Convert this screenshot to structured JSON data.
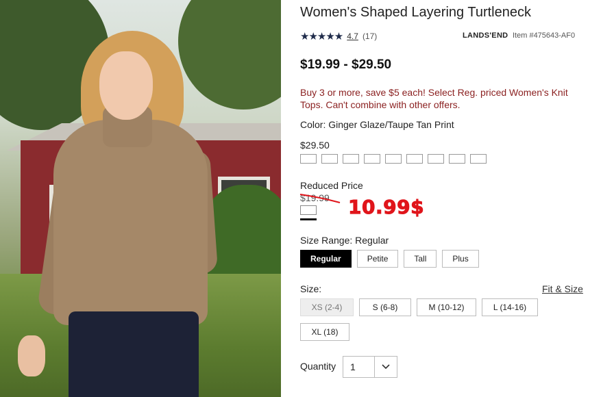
{
  "product": {
    "title": "Women's Shaped Layering Turtleneck",
    "rating_stars": "★★★★★",
    "rating_value": "4.7",
    "rating_count": "(17)",
    "brand": "LANDS'END",
    "item_number": "Item #475643-AF0",
    "price_range": "$19.99 - $29.50",
    "promo_text": "Buy 3 or more, save $5 each! Select Reg. priced Women's Knit Tops. Can't combine with other offers.",
    "color_line": "Color: Ginger Glaze/Taupe Tan Print"
  },
  "pricing": {
    "regular_price": "$29.50",
    "regular_swatch_count": 9,
    "reduced_label": "Reduced Price",
    "reduced_old_price": "$19.99",
    "handwritten_price": "10.99$"
  },
  "size_range": {
    "label": "Size Range: Regular",
    "options": [
      "Regular",
      "Petite",
      "Tall",
      "Plus"
    ],
    "selected": "Regular"
  },
  "size": {
    "label": "Size:",
    "fit_link": "Fit & Size",
    "options": [
      "XS (2-4)",
      "S (6-8)",
      "M (10-12)",
      "L (14-16)",
      "XL (18)"
    ],
    "unavailable": "XS (2-4)"
  },
  "quantity": {
    "label": "Quantity",
    "value": "1"
  },
  "colors": {
    "promo": "#8a1f1f",
    "annotation_red": "#e0151b",
    "selected_button": "#000000"
  }
}
